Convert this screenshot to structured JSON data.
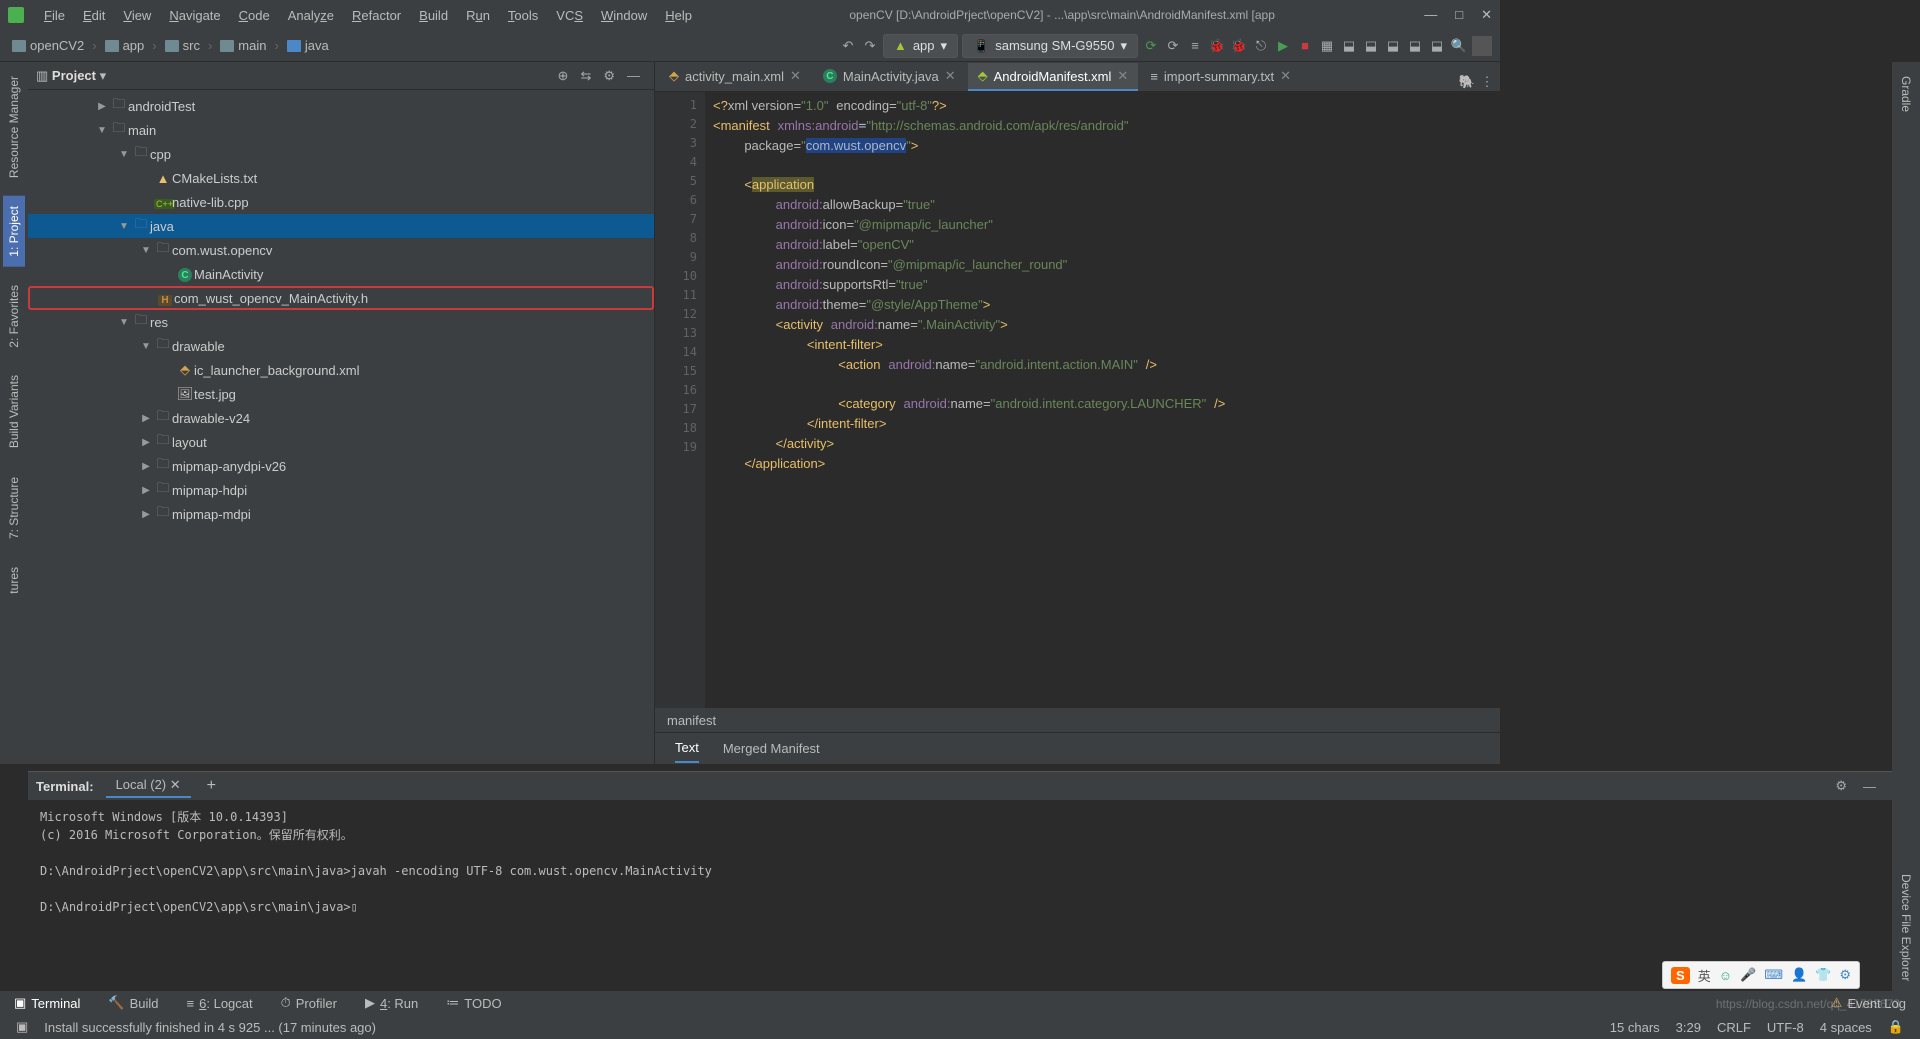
{
  "window": {
    "title": "openCV [D:\\AndroidPrject\\openCV2] - ...\\app\\src\\main\\AndroidManifest.xml [app"
  },
  "menu": [
    "File",
    "Edit",
    "View",
    "Navigate",
    "Code",
    "Analyze",
    "Refactor",
    "Build",
    "Run",
    "Tools",
    "VCS",
    "Window",
    "Help"
  ],
  "breadcrumbs": [
    "openCV2",
    "app",
    "src",
    "main",
    "java"
  ],
  "run": {
    "config": "app",
    "device": "samsung SM-G9550"
  },
  "project_panel": {
    "title": "Project"
  },
  "tree": [
    {
      "indent": 3,
      "arrow": "▶",
      "icon": "folder",
      "label": "androidTest"
    },
    {
      "indent": 3,
      "arrow": "▼",
      "icon": "folder",
      "label": "main"
    },
    {
      "indent": 4,
      "arrow": "▼",
      "icon": "folder",
      "label": "cpp"
    },
    {
      "indent": 5,
      "arrow": "",
      "icon": "cmake",
      "label": "CMakeLists.txt"
    },
    {
      "indent": 5,
      "arrow": "",
      "icon": "cpp",
      "label": "native-lib.cpp"
    },
    {
      "indent": 4,
      "arrow": "▼",
      "icon": "folder-blue",
      "label": "java",
      "selected": true
    },
    {
      "indent": 5,
      "arrow": "▼",
      "icon": "pkg",
      "label": "com.wust.opencv"
    },
    {
      "indent": 6,
      "arrow": "",
      "icon": "class",
      "label": "MainActivity"
    },
    {
      "indent": 5,
      "arrow": "",
      "icon": "h",
      "label": "com_wust_opencv_MainActivity.h",
      "highlighted": true
    },
    {
      "indent": 4,
      "arrow": "▼",
      "icon": "folder",
      "label": "res"
    },
    {
      "indent": 5,
      "arrow": "▼",
      "icon": "folder",
      "label": "drawable"
    },
    {
      "indent": 6,
      "arrow": "",
      "icon": "xml",
      "label": "ic_launcher_background.xml"
    },
    {
      "indent": 6,
      "arrow": "",
      "icon": "img",
      "label": "test.jpg"
    },
    {
      "indent": 5,
      "arrow": "▶",
      "icon": "folder",
      "label": "drawable-v24"
    },
    {
      "indent": 5,
      "arrow": "▶",
      "icon": "folder",
      "label": "layout"
    },
    {
      "indent": 5,
      "arrow": "▶",
      "icon": "folder",
      "label": "mipmap-anydpi-v26"
    },
    {
      "indent": 5,
      "arrow": "▶",
      "icon": "folder",
      "label": "mipmap-hdpi"
    },
    {
      "indent": 5,
      "arrow": "▶",
      "icon": "folder",
      "label": "mipmap-mdpi"
    }
  ],
  "editor_tabs": [
    {
      "label": "activity_main.xml",
      "icon": "xml"
    },
    {
      "label": "MainActivity.java",
      "icon": "class"
    },
    {
      "label": "AndroidManifest.xml",
      "icon": "mf",
      "active": true
    },
    {
      "label": "import-summary.txt",
      "icon": "txt"
    }
  ],
  "code_lines": 19,
  "code": {
    "l1": "<?xml version=\"1.0\" encoding=\"utf-8\"?>",
    "pkg": "com.wust.opencv",
    "schema": "http://schemas.android.com/apk/res/android",
    "allowBackup": "true",
    "icon": "@mipmap/ic_launcher",
    "label": "openCV",
    "roundIcon": "@mipmap/ic_launcher_round",
    "supportsRtl": "true",
    "theme": "@style/AppTheme",
    "activityName": ".MainActivity",
    "actionName": "android.intent.action.MAIN",
    "categoryName": "android.intent.category.LAUNCHER"
  },
  "breadcrumb_bar": "manifest",
  "sub_tabs": [
    "Text",
    "Merged Manifest"
  ],
  "terminal": {
    "title": "Terminal:",
    "tab": "Local (2)",
    "lines": [
      "Microsoft Windows [版本 10.0.14393]",
      "(c) 2016 Microsoft Corporation。保留所有权利。",
      "",
      "D:\\AndroidPrject\\openCV2\\app\\src\\main\\java>javah -encoding UTF-8 com.wust.opencv.MainActivity",
      "",
      "D:\\AndroidPrject\\openCV2\\app\\src\\main\\java>▯"
    ]
  },
  "bottom_tabs": [
    {
      "icon": "▣",
      "label": "Terminal",
      "active": true
    },
    {
      "icon": "🔨",
      "label": "Build"
    },
    {
      "icon": "≡",
      "label": "6: Logcat",
      "u": "6"
    },
    {
      "icon": "⏱",
      "label": "Profiler"
    },
    {
      "icon": "▶",
      "label": "4: Run",
      "u": "4"
    },
    {
      "icon": "≔",
      "label": "TODO"
    }
  ],
  "event_log": "Event Log",
  "status": {
    "message": "Install successfully finished in 4 s 925 ... (17 minutes ago)",
    "chars": "15 chars",
    "pos": "3:29",
    "eol": "CRLF",
    "enc": "UTF-8",
    "indent": "4 spaces"
  },
  "left_tabs": [
    "Resource Manager",
    "1: Project",
    "2: Favorites",
    "Build Variants",
    "7: Structure",
    "tures"
  ],
  "right_tabs": [
    "Gradle",
    "Device File Explorer"
  ],
  "ime": {
    "logo": "S",
    "lang": "英"
  },
  "watermark": "https://blog.csdn.net/qq_41785673"
}
